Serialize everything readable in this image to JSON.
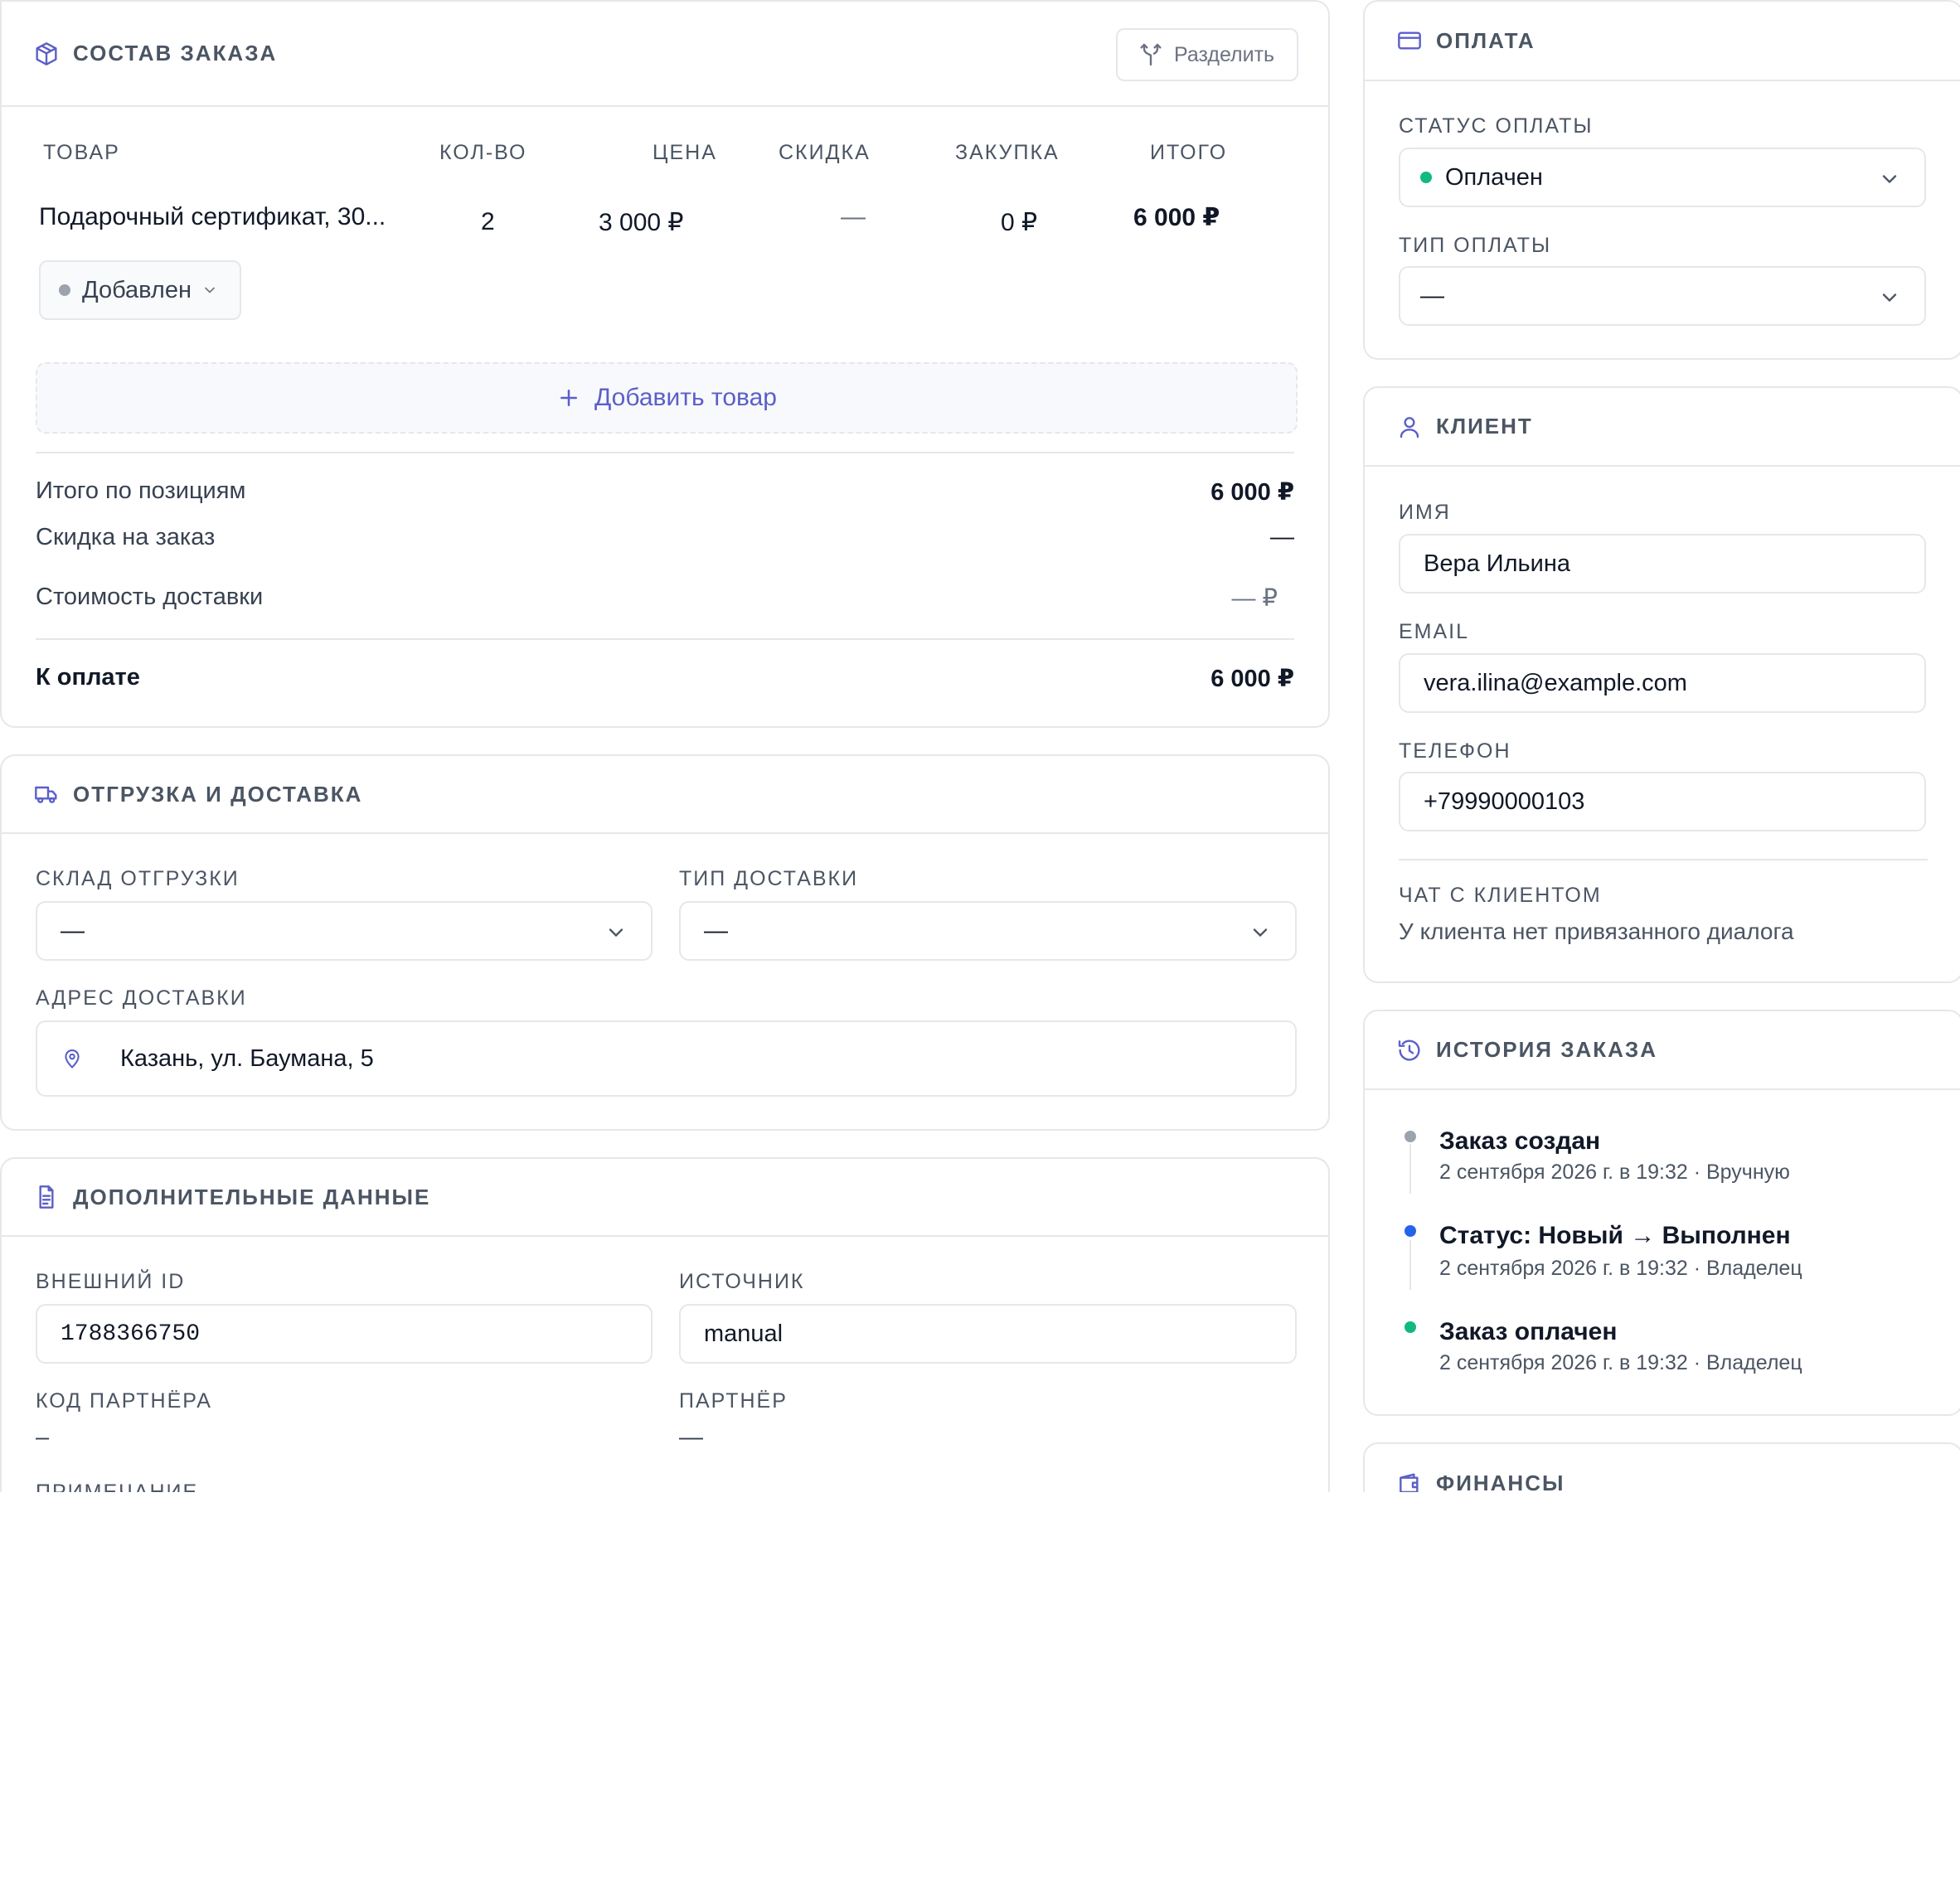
{
  "order": {
    "title": "СОСТАВ ЗАКАЗА",
    "split_label": "Разделить",
    "columns": [
      "ТОВАР",
      "КОЛ-ВО",
      "ЦЕНА",
      "СКИДКА",
      "ЗАКУПКА",
      "ИТОГО"
    ],
    "item": {
      "name": "Подарочный сертификат, 30...",
      "qty": "2",
      "price": "3 000 ₽",
      "discount": "—",
      "purchase": "0 ₽",
      "total": "6 000 ₽",
      "status": "Добавлен"
    },
    "add_item_label": "Добавить товар",
    "summary": {
      "items_total_label": "Итого по позициям",
      "items_total": "6 000 ₽",
      "order_discount_label": "Скидка на заказ",
      "order_discount": "—",
      "delivery_cost_label": "Стоимость доставки",
      "delivery_cost": "— ₽",
      "to_pay_label": "К оплате",
      "to_pay": "6 000 ₽"
    }
  },
  "shipping": {
    "title": "ОТГРУЗКА И ДОСТАВКА",
    "warehouse_label": "СКЛАД ОТГРУЗКИ",
    "warehouse_value": "—",
    "delivery_type_label": "ТИП ДОСТАВКИ",
    "delivery_type_value": "—",
    "address_label": "АДРЕС ДОСТАВКИ",
    "address_value": "Казань, ул. Баумана, 5"
  },
  "extra": {
    "title": "ДОПОЛНИТЕЛЬНЫЕ ДАННЫЕ",
    "external_id_label": "ВНЕШНИЙ ID",
    "external_id": "1788366750",
    "source_label": "ИСТОЧНИК",
    "source": "manual",
    "partner_code_label": "КОД ПАРТНЁРА",
    "partner_code": "–",
    "partner_label": "ПАРТНЁР",
    "partner": "—",
    "note_label": "ПРИМЕЧАНИЕ"
  },
  "payment": {
    "title": "ОПЛАТА",
    "status_label": "СТАТУС ОПЛАТЫ",
    "status_value": "Оплачен",
    "type_label": "ТИП ОПЛАТЫ",
    "type_value": "—"
  },
  "client": {
    "title": "КЛИЕНТ",
    "name_label": "ИМЯ",
    "name": "Вера Ильина",
    "email_label": "EMAIL",
    "email": "vera.ilina@example.com",
    "phone_label": "ТЕЛЕФОН",
    "phone": "+79990000103",
    "chat_label": "ЧАТ С КЛИЕНТОМ",
    "chat_value": "У клиента нет привязанного диалога"
  },
  "history": {
    "title": "ИСТОРИЯ ЗАКАЗА",
    "events": [
      {
        "title": "Заказ создан",
        "meta": "2 сентября 2026 г. в 19:32 · Вручную",
        "color": "#9ca3af"
      },
      {
        "title": "Статус: Новый → Выполнен",
        "meta": "2 сентября 2026 г. в 19:32 · Владелец",
        "color": "#2563eb"
      },
      {
        "title": "Заказ оплачен",
        "meta": "2 сентября 2026 г. в 19:32 · Владелец",
        "color": "#10b981"
      }
    ]
  },
  "finance": {
    "title": "ФИНАНСЫ"
  },
  "colors": {
    "accent": "#5b5fc7",
    "paid_green": "#10b981",
    "status_gray": "#9ca3af",
    "history_blue": "#2563eb"
  }
}
